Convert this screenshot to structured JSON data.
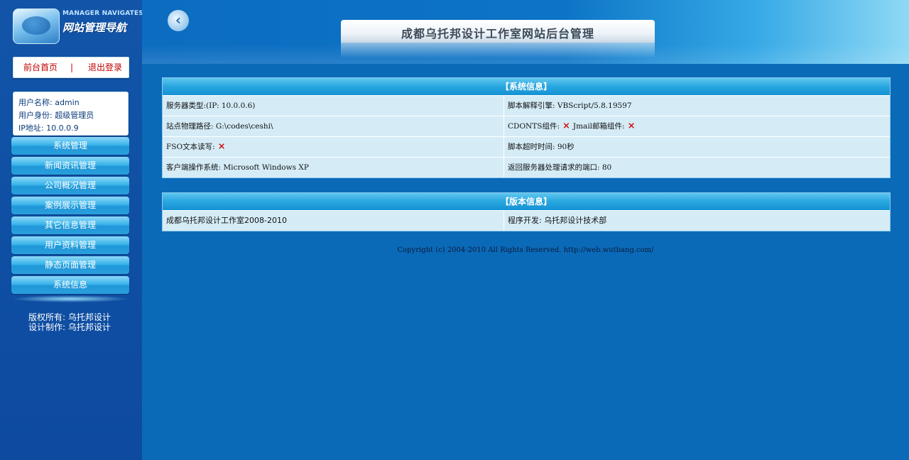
{
  "sidebar": {
    "logo_en": "MANAGER NAVIGATES",
    "logo_cn": "网站管理导航",
    "quick_links": {
      "home": "前台首页",
      "sep": "|",
      "logout": "退出登录"
    },
    "user": {
      "name": "用户名称: admin",
      "role": "用户身份: 超级管理员",
      "ip": "IP地址: 10.0.0.9"
    },
    "menu": [
      "系统管理",
      "新闻资讯管理",
      "公司概况管理",
      "案例展示管理",
      "其它信息管理",
      "用户资料管理",
      "静态页面管理",
      "系统信息"
    ],
    "copyright": [
      "版权所有: 乌托邦设计",
      "设计制作: 乌托邦设计"
    ]
  },
  "header": {
    "title": "成都乌托邦设计工作室网站后台管理",
    "back": "‹"
  },
  "system_info": {
    "heading": "【系统信息】",
    "rows": [
      {
        "left": "服务器类型:(IP: 10.0.0.6)",
        "right": "脚本解释引擎: VBScript/5.8.19597"
      },
      {
        "left": "站点物理路径: G:\\codes\\ceshi\\",
        "right_a": "CDONTS组件:",
        "right_b": "Jmail邮箱组件:"
      },
      {
        "left_a": "FSO文本读写:",
        "right": "脚本超时时间: 90秒"
      },
      {
        "left": "客户端操作系统:  Microsoft Windows XP",
        "right": "返回服务器处理请求的端口: 80"
      }
    ],
    "x_mark": "×"
  },
  "version_info": {
    "heading": "【版本信息】",
    "left": "成都乌托邦设计工作室2008-2010",
    "right": "程序开发: 乌托邦设计技术部"
  },
  "footer": "Copyright (c) 2004-2010 All Rights Reserved.  http://web.wutbang.com/"
}
